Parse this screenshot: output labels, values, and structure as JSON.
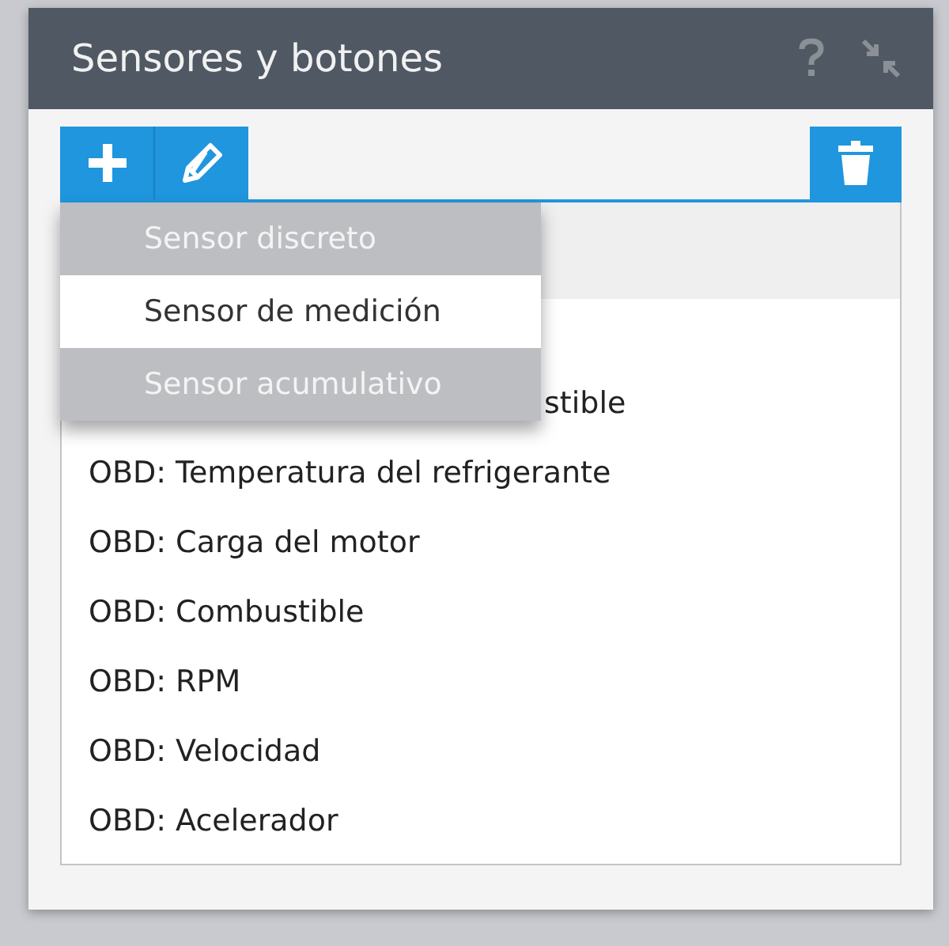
{
  "window": {
    "title": "Sensores y botones"
  },
  "add_menu": {
    "items": [
      {
        "label": "Sensor discreto",
        "selected": false
      },
      {
        "label": "Sensor de medición",
        "selected": true
      },
      {
        "label": "Sensor acumulativo",
        "selected": false
      }
    ]
  },
  "list": {
    "partial_row": "stible",
    "rows": [
      "OBD: Temperatura del refrigerante",
      "OBD: Carga del motor",
      "OBD: Combustible",
      "OBD: RPM",
      "OBD: Velocidad",
      "OBD: Acelerador"
    ]
  }
}
